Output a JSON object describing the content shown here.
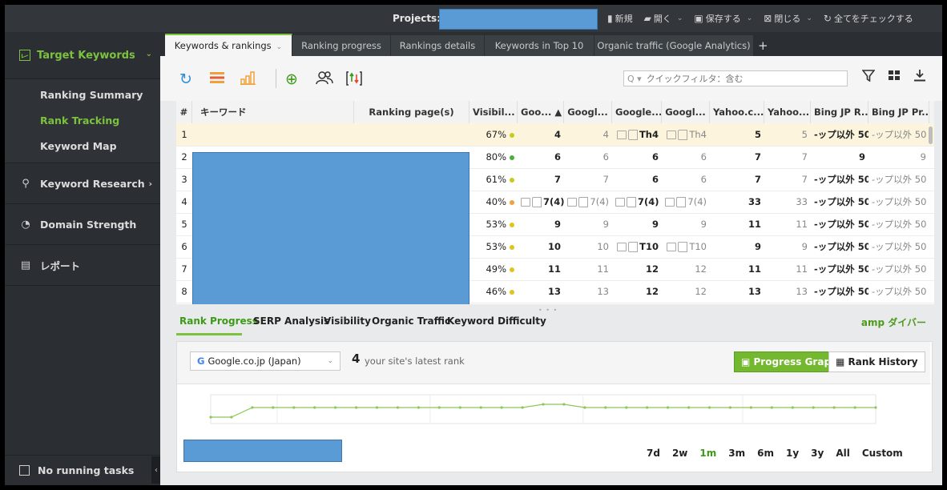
{
  "colors": {
    "accent": "#7cc23f",
    "highlight_row": "#fcf4dc",
    "redacted": "#5b9bd5"
  },
  "topbar": {
    "projects_label": "Projects:",
    "actions": [
      {
        "icon": "new-file-icon",
        "label": "新規"
      },
      {
        "icon": "folder-open-icon",
        "label": "開く"
      },
      {
        "icon": "save-icon",
        "label": "保存する"
      },
      {
        "icon": "close-box-icon",
        "label": "閉じる"
      },
      {
        "icon": "refresh-check-icon",
        "label": "全てをチェックする"
      }
    ]
  },
  "sidebar": {
    "header": "Target Keywords",
    "sub_items": [
      {
        "label": "Ranking Summary",
        "active": false
      },
      {
        "label": "Rank Tracking",
        "active": true
      },
      {
        "label": "Keyword Map",
        "active": false
      }
    ],
    "sections": [
      {
        "label": "Keyword Research",
        "icon": "search-icon"
      },
      {
        "label": "Domain Strength",
        "icon": "gauge-icon"
      },
      {
        "label": "レポート",
        "icon": "report-icon"
      }
    ],
    "tasks": "No running tasks"
  },
  "tabs": [
    {
      "label": "Keywords & rankings",
      "active": true
    },
    {
      "label": "Ranking progress",
      "active": false
    },
    {
      "label": "Rankings details",
      "active": false
    },
    {
      "label": "Keywords in Top 10",
      "active": false
    },
    {
      "label": "Organic traffic (Google Analytics)",
      "active": false
    }
  ],
  "toolbar": {
    "quick_filter_placeholder": "クイックフィルタ：含む",
    "quick_filter_prefix": "Q ▾"
  },
  "table": {
    "columns": [
      "#",
      "キーワード",
      "Ranking page(s)",
      "Visibil...",
      "Goo... ▲",
      "Googl...",
      "Google...",
      "Googl...",
      "Yahoo.c...",
      "Yahoo...",
      "Bing JP R...",
      "Bing JP Pr..."
    ],
    "rows": [
      {
        "n": "1",
        "vis": "67%",
        "vis_color": "#c9c922",
        "c1": "4",
        "c2": "4",
        "c3": "Th4",
        "c3icons": true,
        "c4": "Th4",
        "c4icons": true,
        "y1": "5",
        "y2": "5",
        "b1": "-ップ以外 50",
        "b2": "-ップ以外 50"
      },
      {
        "n": "2",
        "vis": "80%",
        "vis_color": "#4cae3a",
        "c1": "6",
        "c2": "6",
        "c3": "6",
        "c3icons": false,
        "c4": "6",
        "c4icons": false,
        "y1": "7",
        "y2": "7",
        "b1": "9",
        "b2": "9"
      },
      {
        "n": "3",
        "vis": "61%",
        "vis_color": "#c9c922",
        "c1": "7",
        "c2": "7",
        "c3": "6",
        "c3icons": false,
        "c4": "6",
        "c4icons": false,
        "y1": "7",
        "y2": "7",
        "b1": "-ップ以外 50",
        "b2": "-ップ以外 50"
      },
      {
        "n": "4",
        "vis": "40%",
        "vis_color": "#f0a23a",
        "c1": "7(4)",
        "c1icons": true,
        "c2": "7(4)",
        "c2icons": true,
        "c3": "7(4)",
        "c3icons": true,
        "c4": "7(4)",
        "c4icons": true,
        "y1": "33",
        "y2": "33",
        "b1": "-ップ以外 50",
        "b2": "-ップ以外 50"
      },
      {
        "n": "5",
        "vis": "53%",
        "vis_color": "#e3c21b",
        "c1": "9",
        "c2": "9",
        "c3": "9",
        "c3icons": false,
        "c4": "9",
        "c4icons": false,
        "y1": "11",
        "y2": "11",
        "b1": "-ップ以外 50",
        "b2": "-ップ以外 50"
      },
      {
        "n": "6",
        "vis": "53%",
        "vis_color": "#e3c21b",
        "c1": "10",
        "c2": "10",
        "c3": "T10",
        "c3icons": true,
        "c4": "T10",
        "c4icons": true,
        "y1": "9",
        "y2": "9",
        "b1": "-ップ以外 50",
        "b2": "-ップ以外 50"
      },
      {
        "n": "7",
        "vis": "49%",
        "vis_color": "#e3c21b",
        "c1": "11",
        "c2": "11",
        "c3": "12",
        "c3icons": false,
        "c4": "12",
        "c4icons": false,
        "y1": "11",
        "y2": "11",
        "b1": "-ップ以外 50",
        "b2": "-ップ以外 50"
      },
      {
        "n": "8",
        "vis": "46%",
        "vis_color": "#e3c21b",
        "c1": "13",
        "c2": "13",
        "c3": "12",
        "c3icons": false,
        "c4": "12",
        "c4icons": false,
        "y1": "13",
        "y2": "13",
        "b1": "-ップ以外 50",
        "b2": "-ップ以外 50"
      }
    ]
  },
  "bottom_tabs": [
    "Rank Progress",
    "SERP Analysis",
    "Visibility",
    "Organic Traffic",
    "Keyword Difficulty"
  ],
  "amp_link": "amp ダイバー",
  "panel": {
    "engine": "Google.co.jp (Japan)",
    "rank": "4",
    "rank_label": "your site's latest rank",
    "progress_graph_label": "Progress Graph",
    "rank_history_label": "Rank History",
    "ranges": [
      {
        "label": "7d",
        "active": false
      },
      {
        "label": "2w",
        "active": false
      },
      {
        "label": "1m",
        "active": true
      },
      {
        "label": "3m",
        "active": false
      },
      {
        "label": "6m",
        "active": false
      },
      {
        "label": "1y",
        "active": false
      },
      {
        "label": "3y",
        "active": false
      },
      {
        "label": "All",
        "active": false
      },
      {
        "label": "Custom",
        "active": false
      }
    ]
  },
  "chart_data": {
    "type": "line",
    "title": "",
    "xlabel": "",
    "ylabel": "",
    "ylim": [
      1,
      10
    ],
    "y_inverted": true,
    "series": [
      {
        "values": [
          8,
          8,
          5,
          5,
          5,
          5,
          5,
          5,
          5,
          5,
          5,
          5,
          5,
          5,
          5,
          5,
          4,
          4,
          5,
          5,
          5,
          5,
          5,
          5,
          5,
          5,
          5,
          5,
          5,
          5,
          5,
          5,
          5
        ]
      }
    ]
  }
}
